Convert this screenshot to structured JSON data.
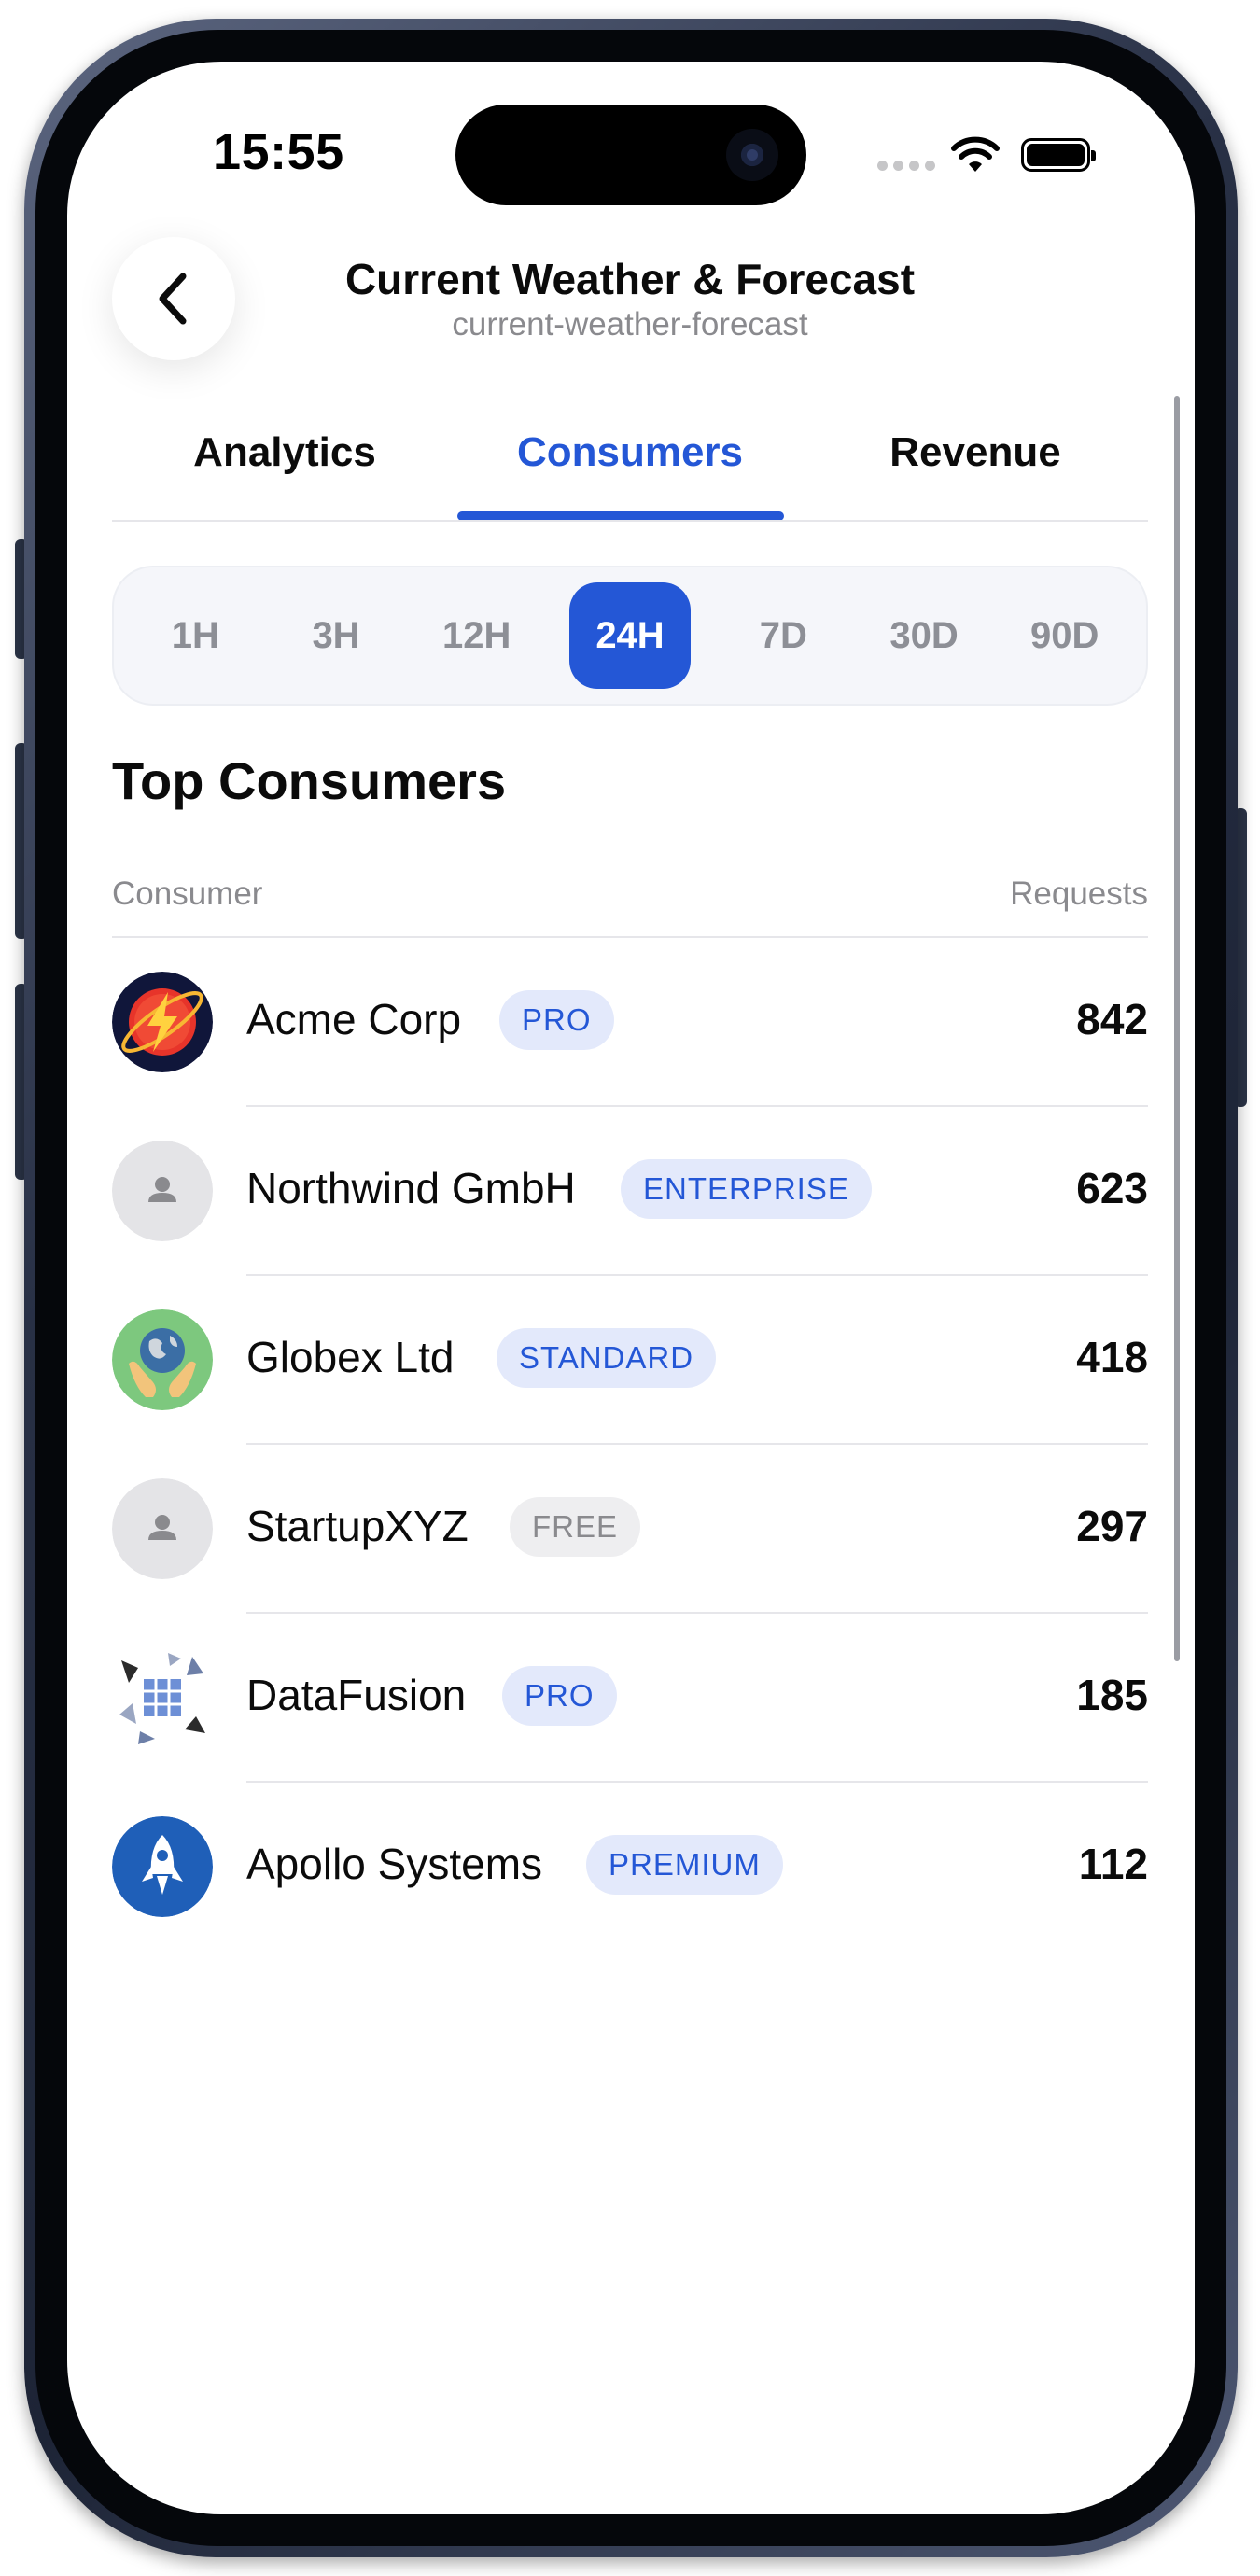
{
  "status_bar": {
    "time": "15:55"
  },
  "header": {
    "title": "Current Weather & Forecast",
    "subtitle": "current-weather-forecast",
    "back_icon": "chevron-left-icon"
  },
  "tabs": [
    {
      "label": "Analytics",
      "active": false
    },
    {
      "label": "Consumers",
      "active": true
    },
    {
      "label": "Revenue",
      "active": false
    }
  ],
  "time_ranges": [
    {
      "label": "1H",
      "active": false
    },
    {
      "label": "3H",
      "active": false
    },
    {
      "label": "12H",
      "active": false
    },
    {
      "label": "24H",
      "active": true
    },
    {
      "label": "7D",
      "active": false
    },
    {
      "label": "30D",
      "active": false
    },
    {
      "label": "90D",
      "active": false
    }
  ],
  "section": {
    "title": "Top Consumers",
    "column_consumer": "Consumer",
    "column_requests": "Requests"
  },
  "consumers": [
    {
      "name": "Acme Corp",
      "tier": "PRO",
      "requests": "842",
      "avatar": "lightning-logo-icon"
    },
    {
      "name": "Northwind GmbH",
      "tier": "ENTERPRISE",
      "requests": "623",
      "avatar": "person-placeholder-icon"
    },
    {
      "name": "Globex Ltd",
      "tier": "STANDARD",
      "requests": "418",
      "avatar": "globe-hands-logo-icon"
    },
    {
      "name": "StartupXYZ",
      "tier": "FREE",
      "requests": "297",
      "avatar": "person-placeholder-icon"
    },
    {
      "name": "DataFusion",
      "tier": "PRO",
      "requests": "185",
      "avatar": "geometric-grid-logo-icon"
    },
    {
      "name": "Apollo Systems",
      "tier": "PREMIUM",
      "requests": "112",
      "avatar": "rocket-logo-icon"
    }
  ],
  "colors": {
    "accent": "#2457d6",
    "badge_bg": "#e3e9fb",
    "free_badge_bg": "#eeeef0",
    "muted_text": "#8a8a8e"
  }
}
